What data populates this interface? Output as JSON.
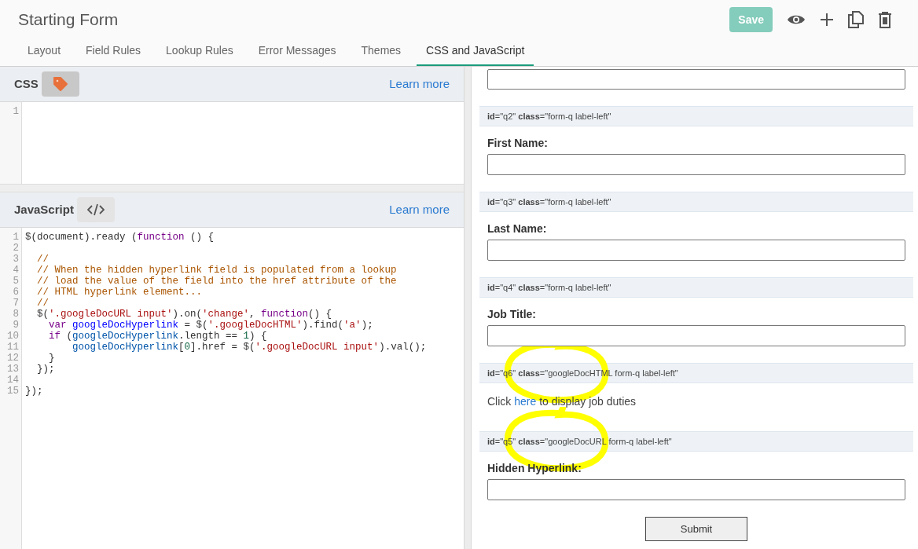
{
  "title": "Starting Form",
  "actions": [
    {
      "kind": "save",
      "label": "Save",
      "disabled": true
    },
    {
      "kind": "preview"
    },
    {
      "kind": "add"
    },
    {
      "kind": "copy"
    },
    {
      "kind": "delete"
    }
  ],
  "tabs": [
    {
      "label": "Layout",
      "selected": false
    },
    {
      "label": "Field Rules",
      "selected": false
    },
    {
      "label": "Lookup Rules",
      "selected": false
    },
    {
      "label": "Error Messages",
      "selected": false
    },
    {
      "label": "Themes",
      "selected": false
    },
    {
      "label": "CSS and JavaScript",
      "selected": true
    }
  ],
  "css_panel": {
    "title": "CSS",
    "link": "Learn more",
    "line_numbers": [
      "1"
    ]
  },
  "js_panel": {
    "title": "JavaScript",
    "link": "Learn more",
    "line_numbers": [
      "1",
      "2",
      "3",
      "4",
      "5",
      "6",
      "7",
      "8",
      "9",
      "10",
      "11",
      "12",
      "13",
      "14",
      "15"
    ],
    "lines": [
      {
        "kind": "code",
        "tokens": [
          {
            "kind": "plain",
            "text": "$(document).ready ("
          },
          {
            "kind": "keyword",
            "text": "function"
          },
          {
            "kind": "plain",
            "text": " () {"
          }
        ]
      },
      {
        "kind": "blank"
      },
      {
        "kind": "code",
        "tokens": [
          {
            "kind": "comment",
            "text": "  //"
          }
        ]
      },
      {
        "kind": "code",
        "tokens": [
          {
            "kind": "comment",
            "text": "  // When the hidden hyperlink field is populated from a lookup"
          }
        ]
      },
      {
        "kind": "code",
        "tokens": [
          {
            "kind": "comment",
            "text": "  // load the value of the field into the href attribute of the"
          }
        ]
      },
      {
        "kind": "code",
        "tokens": [
          {
            "kind": "comment",
            "text": "  // HTML hyperlink element..."
          }
        ]
      },
      {
        "kind": "code",
        "tokens": [
          {
            "kind": "comment",
            "text": "  //"
          }
        ]
      },
      {
        "kind": "code",
        "tokens": [
          {
            "kind": "plain",
            "text": "  $("
          },
          {
            "kind": "string",
            "text": "'.googleDocURL input'"
          },
          {
            "kind": "plain",
            "text": ").on("
          },
          {
            "kind": "string",
            "text": "'change'"
          },
          {
            "kind": "plain",
            "text": ", "
          },
          {
            "kind": "keyword",
            "text": "function"
          },
          {
            "kind": "plain",
            "text": "() {"
          }
        ]
      },
      {
        "kind": "code",
        "tokens": [
          {
            "kind": "keyword",
            "text": "    var"
          },
          {
            "kind": "def",
            "text": " googleDocHyperlink"
          },
          {
            "kind": "plain",
            "text": " = $("
          },
          {
            "kind": "string",
            "text": "'.googleDocHTML'"
          },
          {
            "kind": "plain",
            "text": ").find("
          },
          {
            "kind": "string",
            "text": "'a'"
          },
          {
            "kind": "plain",
            "text": ");"
          }
        ]
      },
      {
        "kind": "code",
        "tokens": [
          {
            "kind": "keyword",
            "text": "    if"
          },
          {
            "kind": "plain",
            "text": " ("
          },
          {
            "kind": "variable",
            "text": "googleDocHyperlink"
          },
          {
            "kind": "plain",
            "text": ".length == "
          },
          {
            "kind": "number",
            "text": "1"
          },
          {
            "kind": "plain",
            "text": ") {"
          }
        ]
      },
      {
        "kind": "code",
        "tokens": [
          {
            "kind": "variable",
            "text": "        googleDocHyperlink"
          },
          {
            "kind": "plain",
            "text": "["
          },
          {
            "kind": "number",
            "text": "0"
          },
          {
            "kind": "plain",
            "text": "].href = $("
          },
          {
            "kind": "string",
            "text": "'.googleDocURL input'"
          },
          {
            "kind": "plain",
            "text": ").val();"
          }
        ]
      },
      {
        "kind": "code",
        "tokens": [
          {
            "kind": "plain",
            "text": "    }"
          }
        ]
      },
      {
        "kind": "code",
        "tokens": [
          {
            "kind": "plain",
            "text": "  });"
          }
        ]
      },
      {
        "kind": "blank"
      },
      {
        "kind": "code",
        "tokens": [
          {
            "kind": "plain",
            "text": "});"
          }
        ]
      }
    ]
  },
  "form": {
    "top_field": {
      "kind": "input"
    },
    "sections": [
      {
        "header": "**id**=\"q2\" **class**=\"form-q label-left\"",
        "kind": "input",
        "label": "First Name:",
        "highlighted": false
      },
      {
        "header": "**id**=\"q3\" **class**=\"form-q label-left\"",
        "kind": "input",
        "label": "Last Name:",
        "highlighted": false
      },
      {
        "header": "**id**=\"q4\" **class**=\"form-q label-left\"",
        "kind": "input",
        "label": "Job Title:",
        "highlighted": false
      },
      {
        "header": "**id**=\"q6\" **class**=\"googleDocHTML form-q label-left\"",
        "kind": "html",
        "text_before": "Click ",
        "link": "here",
        "text_after": " to display job duties",
        "highlighted": true
      },
      {
        "header": "**id**=\"q5\" **class**=\"googleDocURL form-q label-left\"",
        "kind": "input",
        "label": "Hidden Hyperlink:",
        "highlighted": true
      }
    ],
    "submit": "Submit"
  }
}
